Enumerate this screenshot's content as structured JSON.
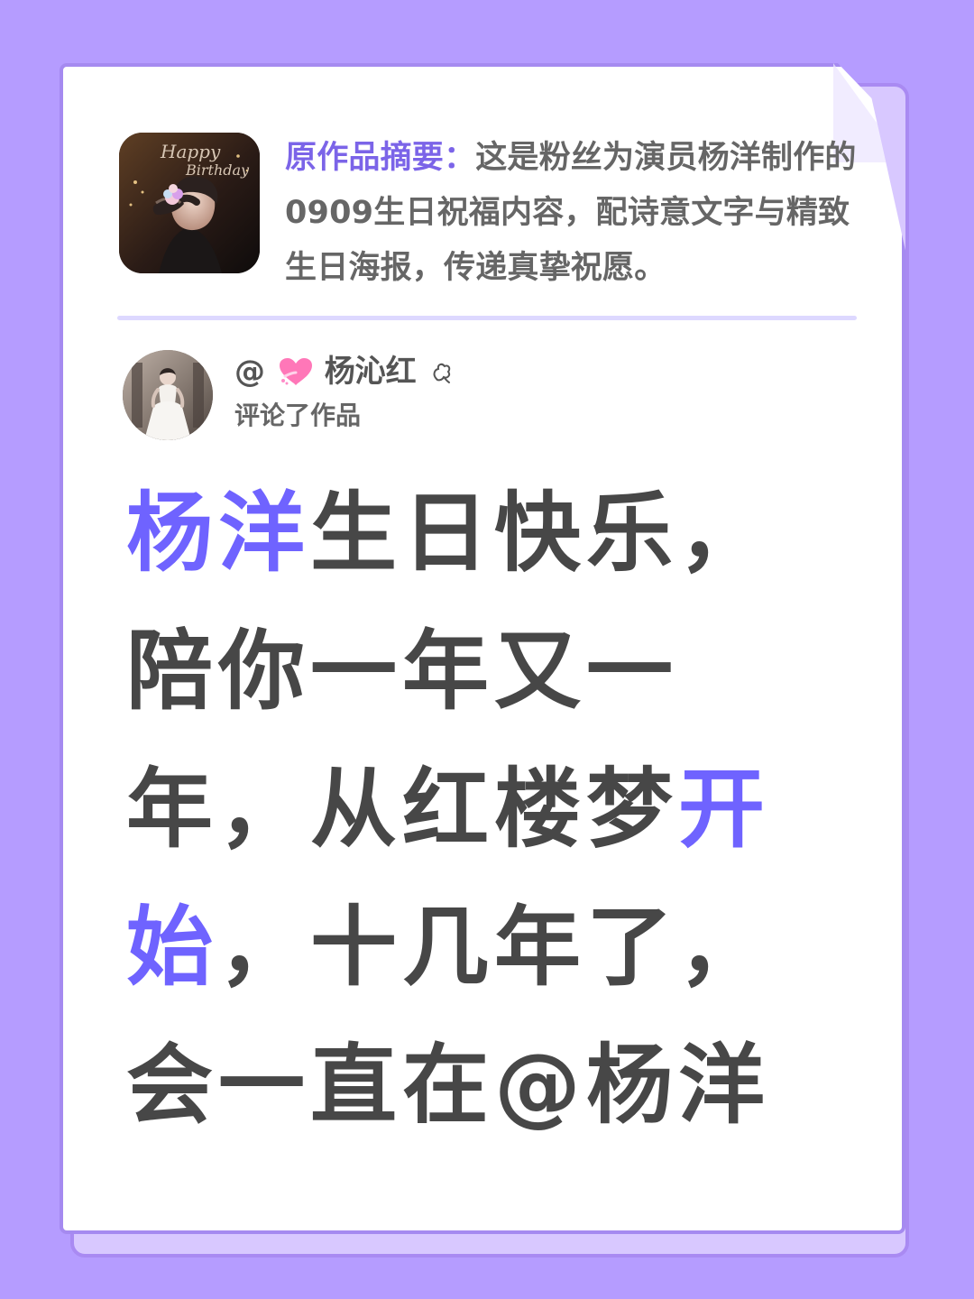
{
  "summary": {
    "label": "原作品摘要：",
    "text": "这是粉丝为演员杨洋制作的0909生日祝福内容，配诗意文字与精致生日海报，传递真挚祝愿。",
    "thumbnail_text_line_1": "Happy",
    "thumbnail_text_line_2": "Birthday"
  },
  "author": {
    "at": "@",
    "name": "杨沁红",
    "subtitle": "评论了作品",
    "emoji_icon": "pink-heart-icon",
    "flower_icon": "small-flower-icon"
  },
  "comment": {
    "parts": [
      {
        "text": "杨洋",
        "highlight": true
      },
      {
        "text": "生日快乐，陪你一年又一年，从红楼梦",
        "highlight": false
      },
      {
        "text": "开始",
        "highlight": true
      },
      {
        "text": "，十几年了，会一直在@杨洋",
        "highlight": false
      }
    ]
  },
  "colors": {
    "background": "#b59cff",
    "paper": "#ffffff",
    "paper_border": "#a58af0",
    "accent": "#6f63ff",
    "summary_label": "#7b64e8",
    "text_primary": "#474747",
    "text_secondary": "#666666"
  }
}
